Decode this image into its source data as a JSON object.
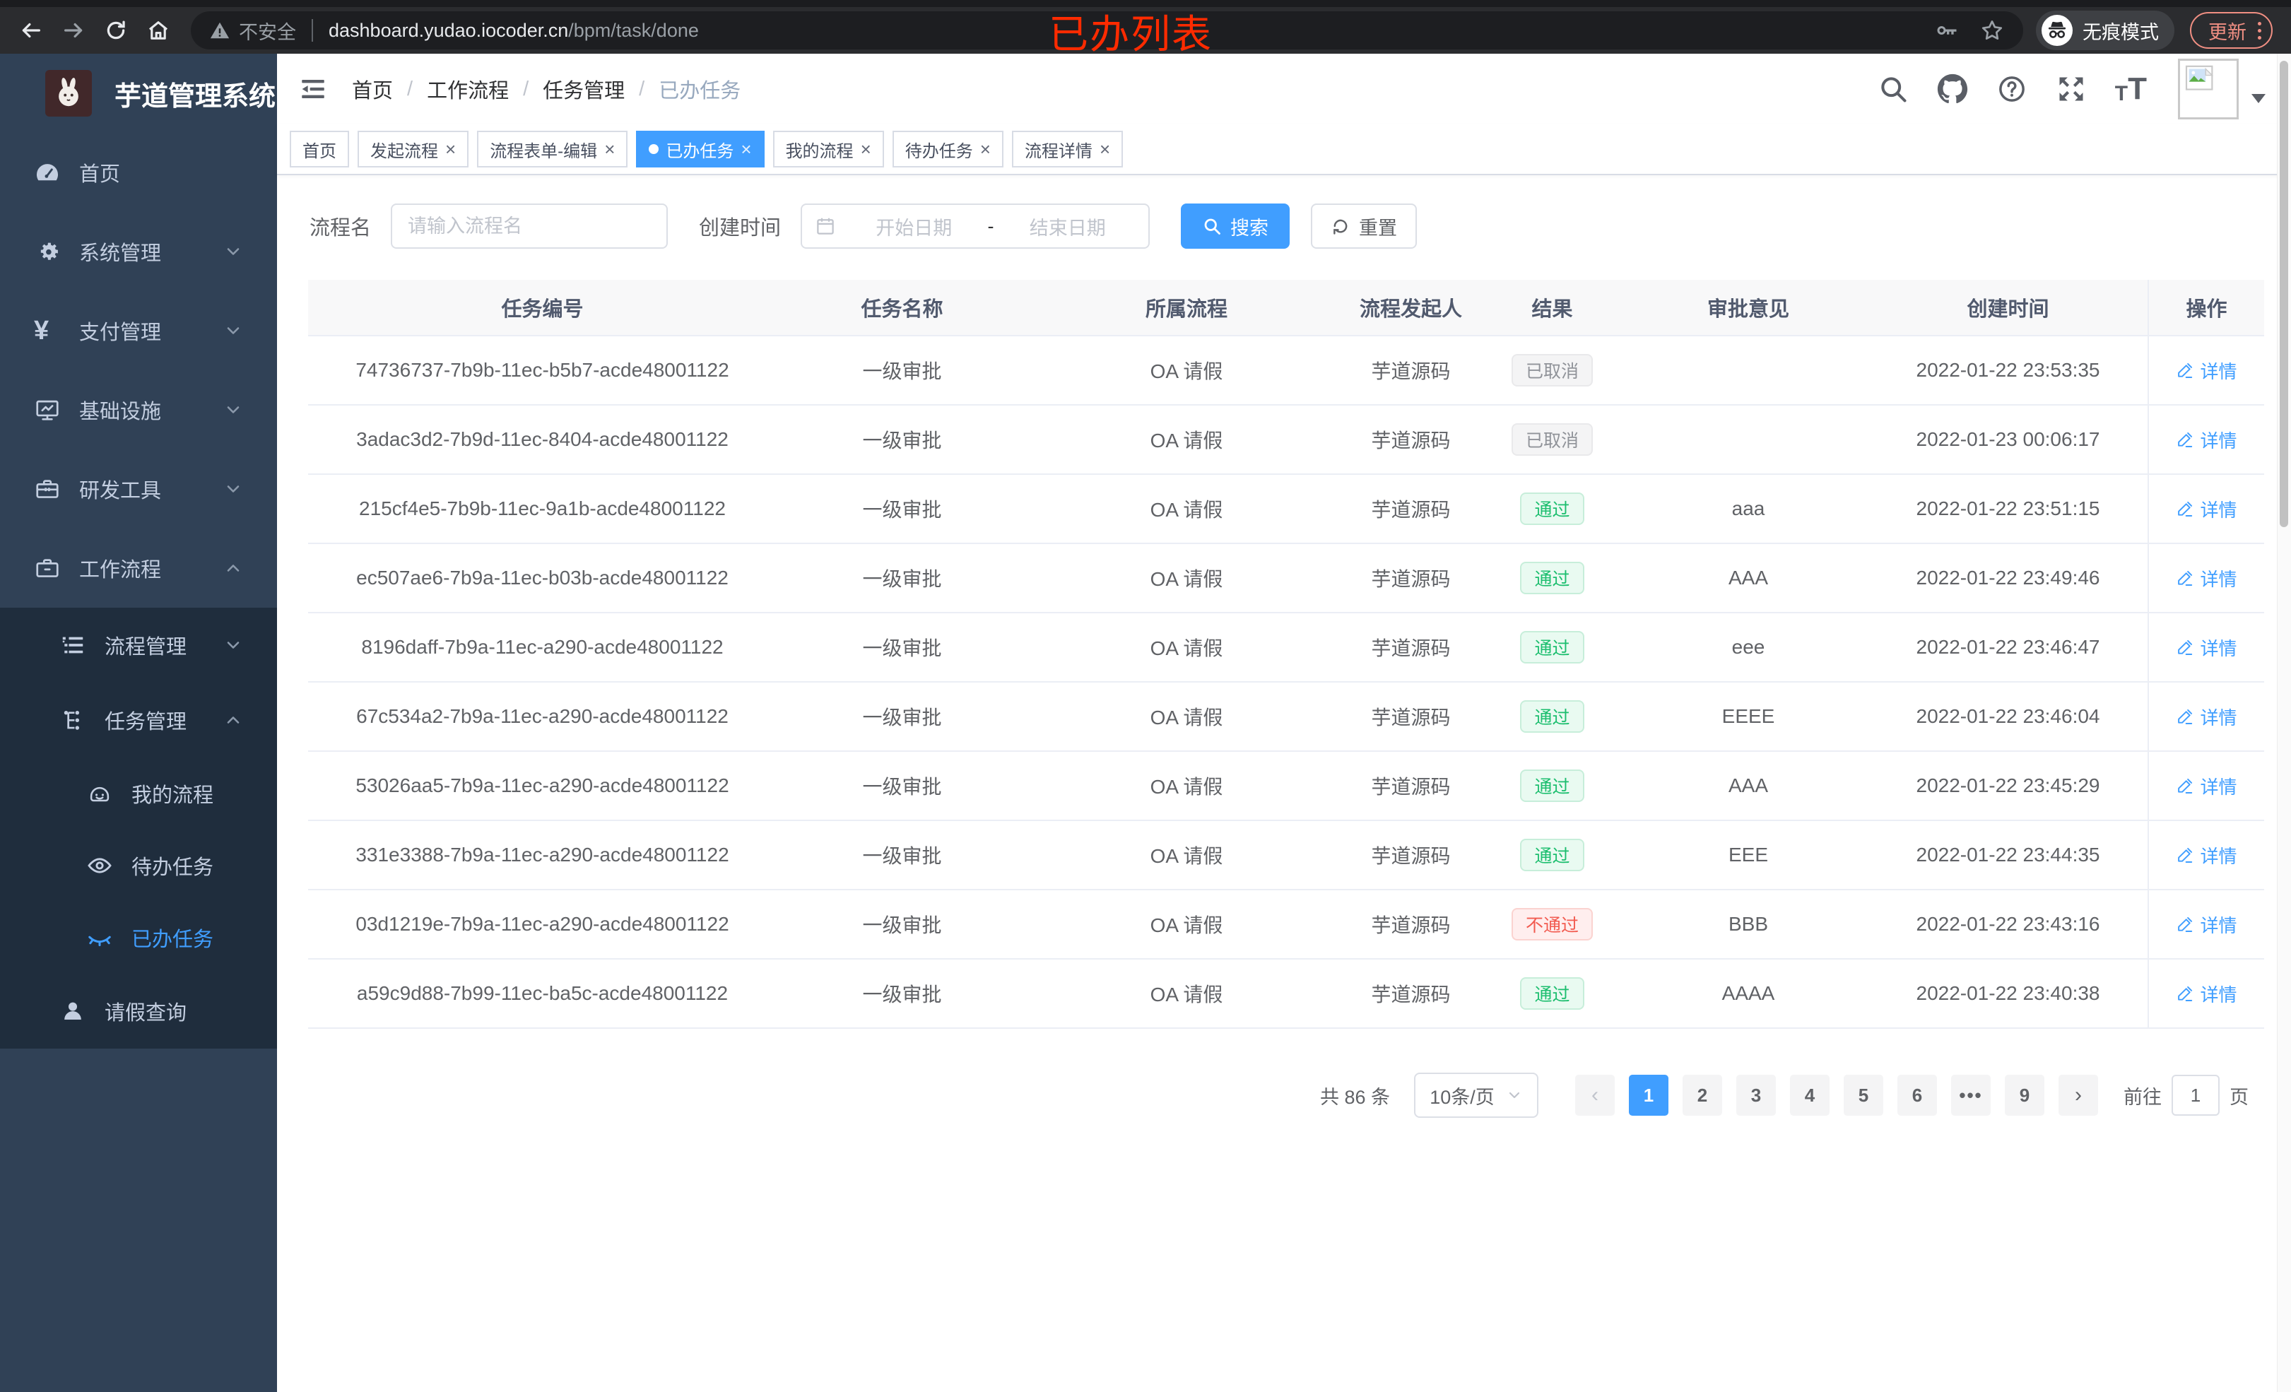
{
  "colors": {
    "accent": "#409eff",
    "success": "#1cbe6e",
    "danger": "#f25b50",
    "info": "#909399",
    "annotation": "#ff2b00"
  },
  "browser": {
    "security_label": "不安全",
    "url_host": "dashboard.yudao.iocoder.cn",
    "url_path": "/bpm/task/done",
    "incognito_label": "无痕模式",
    "update_label": "更新",
    "annotation": "已办列表"
  },
  "sidebar": {
    "app_title": "芋道管理系统",
    "items": [
      {
        "key": "home",
        "icon": "dashboard-icon",
        "label": "首页",
        "level": 1,
        "arrow": "",
        "in_submenu": false,
        "active": false
      },
      {
        "key": "system",
        "icon": "gear-icon",
        "label": "系统管理",
        "level": 1,
        "arrow": "down",
        "in_submenu": false,
        "active": false
      },
      {
        "key": "payment",
        "icon": "yen-icon",
        "label": "支付管理",
        "level": 1,
        "arrow": "down",
        "in_submenu": false,
        "active": false
      },
      {
        "key": "infra",
        "icon": "monitor-icon",
        "label": "基础设施",
        "level": 1,
        "arrow": "down",
        "in_submenu": false,
        "active": false
      },
      {
        "key": "devtools",
        "icon": "toolbox-icon",
        "label": "研发工具",
        "level": 1,
        "arrow": "down",
        "in_submenu": false,
        "active": false
      },
      {
        "key": "workflow",
        "icon": "briefcase-icon",
        "label": "工作流程",
        "level": 1,
        "arrow": "up",
        "in_submenu": false,
        "active": false
      },
      {
        "key": "process-mgmt",
        "icon": "list-tree-icon",
        "label": "流程管理",
        "level": 2,
        "arrow": "down",
        "in_submenu": true,
        "active": false
      },
      {
        "key": "task-mgmt",
        "icon": "org-tree-icon",
        "label": "任务管理",
        "level": 2,
        "arrow": "up",
        "in_submenu": true,
        "active": false
      },
      {
        "key": "my-process",
        "icon": "face-icon",
        "label": "我的流程",
        "level": 3,
        "arrow": "",
        "in_submenu": true,
        "active": false
      },
      {
        "key": "todo-task",
        "icon": "eye-open-icon",
        "label": "待办任务",
        "level": 3,
        "arrow": "",
        "in_submenu": true,
        "active": false
      },
      {
        "key": "done-task",
        "icon": "eye-closed-icon",
        "label": "已办任务",
        "level": 3,
        "arrow": "",
        "in_submenu": true,
        "active": true
      },
      {
        "key": "leave-query",
        "icon": "user-icon",
        "label": "请假查询",
        "level": 2,
        "arrow": "",
        "in_submenu": true,
        "active": false
      }
    ]
  },
  "topbar": {
    "breadcrumb": [
      "首页",
      "工作流程",
      "任务管理",
      "已办任务"
    ]
  },
  "tabs": [
    {
      "key": "home",
      "label": "首页",
      "closable": false,
      "active": false
    },
    {
      "key": "start-process",
      "label": "发起流程",
      "closable": true,
      "active": false
    },
    {
      "key": "form-edit",
      "label": "流程表单-编辑",
      "closable": true,
      "active": false
    },
    {
      "key": "done-task",
      "label": "已办任务",
      "closable": true,
      "active": true
    },
    {
      "key": "my-process",
      "label": "我的流程",
      "closable": true,
      "active": false
    },
    {
      "key": "todo-task",
      "label": "待办任务",
      "closable": true,
      "active": false
    },
    {
      "key": "process-detail",
      "label": "流程详情",
      "closable": true,
      "active": false
    }
  ],
  "filters": {
    "name_label": "流程名",
    "name_placeholder": "请输入流程名",
    "time_label": "创建时间",
    "start_placeholder": "开始日期",
    "range_separator": "-",
    "end_placeholder": "结束日期",
    "search_label": "搜索",
    "reset_label": "重置"
  },
  "table": {
    "columns": [
      "任务编号",
      "任务名称",
      "所属流程",
      "流程发起人",
      "结果",
      "审批意见",
      "创建时间",
      "操作"
    ],
    "detail_label": "详情",
    "rows": [
      {
        "id": "74736737-7b9b-11ec-b5b7-acde48001122",
        "name": "一级审批",
        "process": "OA 请假",
        "starter": "芋道源码",
        "result": "已取消",
        "result_type": "info",
        "comment": "",
        "created": "2022-01-22 23:53:35"
      },
      {
        "id": "3adac3d2-7b9d-11ec-8404-acde48001122",
        "name": "一级审批",
        "process": "OA 请假",
        "starter": "芋道源码",
        "result": "已取消",
        "result_type": "info",
        "comment": "",
        "created": "2022-01-23 00:06:17"
      },
      {
        "id": "215cf4e5-7b9b-11ec-9a1b-acde48001122",
        "name": "一级审批",
        "process": "OA 请假",
        "starter": "芋道源码",
        "result": "通过",
        "result_type": "success",
        "comment": "aaa",
        "created": "2022-01-22 23:51:15"
      },
      {
        "id": "ec507ae6-7b9a-11ec-b03b-acde48001122",
        "name": "一级审批",
        "process": "OA 请假",
        "starter": "芋道源码",
        "result": "通过",
        "result_type": "success",
        "comment": "AAA",
        "created": "2022-01-22 23:49:46"
      },
      {
        "id": "8196daff-7b9a-11ec-a290-acde48001122",
        "name": "一级审批",
        "process": "OA 请假",
        "starter": "芋道源码",
        "result": "通过",
        "result_type": "success",
        "comment": "eee",
        "created": "2022-01-22 23:46:47"
      },
      {
        "id": "67c534a2-7b9a-11ec-a290-acde48001122",
        "name": "一级审批",
        "process": "OA 请假",
        "starter": "芋道源码",
        "result": "通过",
        "result_type": "success",
        "comment": "EEEE",
        "created": "2022-01-22 23:46:04"
      },
      {
        "id": "53026aa5-7b9a-11ec-a290-acde48001122",
        "name": "一级审批",
        "process": "OA 请假",
        "starter": "芋道源码",
        "result": "通过",
        "result_type": "success",
        "comment": "AAA",
        "created": "2022-01-22 23:45:29"
      },
      {
        "id": "331e3388-7b9a-11ec-a290-acde48001122",
        "name": "一级审批",
        "process": "OA 请假",
        "starter": "芋道源码",
        "result": "通过",
        "result_type": "success",
        "comment": "EEE",
        "created": "2022-01-22 23:44:35"
      },
      {
        "id": "03d1219e-7b9a-11ec-a290-acde48001122",
        "name": "一级审批",
        "process": "OA 请假",
        "starter": "芋道源码",
        "result": "不通过",
        "result_type": "danger",
        "comment": "BBB",
        "created": "2022-01-22 23:43:16"
      },
      {
        "id": "a59c9d88-7b99-11ec-ba5c-acde48001122",
        "name": "一级审批",
        "process": "OA 请假",
        "starter": "芋道源码",
        "result": "通过",
        "result_type": "success",
        "comment": "AAAA",
        "created": "2022-01-22 23:40:38"
      }
    ]
  },
  "pagination": {
    "total_label": "共 86 条",
    "page_size_label": "10条/页",
    "prev_label": "‹",
    "next_label": "›",
    "pages": [
      "1",
      "2",
      "3",
      "4",
      "5",
      "6",
      "•••",
      "9"
    ],
    "active_page": "1",
    "goto_label": "前往",
    "goto_value": "1",
    "goto_suffix": "页"
  }
}
